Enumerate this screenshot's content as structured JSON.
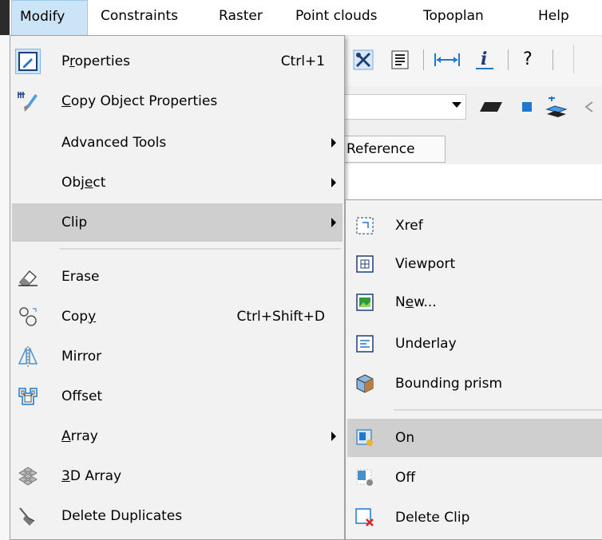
{
  "menubar": {
    "items": [
      {
        "label": "Modify"
      },
      {
        "label": "Constraints"
      },
      {
        "label": "Raster"
      },
      {
        "label": "Point clouds"
      },
      {
        "label": "Topoplan"
      },
      {
        "label": "Help"
      }
    ]
  },
  "background": {
    "reference_tab": "Reference",
    "toolbar_icons": [
      "tools-icon",
      "list-icon",
      "dimension-icon",
      "info-icon",
      "help-icon"
    ],
    "toolbar2_icons": [
      "combo-dropdown-arrow",
      "parallelogram-icon",
      "blue-square-icon",
      "layer-stack-icon"
    ]
  },
  "modify_menu": {
    "items": [
      {
        "label": "Properties",
        "shortcut": "Ctrl+1",
        "icon": "properties-icon",
        "checked": true
      },
      {
        "label": "Copy Object Properties",
        "shortcut": "",
        "icon": "match-properties-brush-icon"
      },
      {
        "label": "Advanced Tools",
        "shortcut": "",
        "submenu": true
      },
      {
        "label": "Object",
        "shortcut": "",
        "submenu": true
      },
      {
        "label": "Clip",
        "shortcut": "",
        "submenu": true,
        "highlighted": true
      },
      {
        "label": "Erase",
        "shortcut": "",
        "icon": "eraser-icon"
      },
      {
        "label": "Copy",
        "shortcut": "Ctrl+Shift+D",
        "icon": "copy-circles-icon"
      },
      {
        "label": "Mirror",
        "shortcut": "",
        "icon": "mirror-icon"
      },
      {
        "label": "Offset",
        "shortcut": "",
        "icon": "offset-icon"
      },
      {
        "label": "Array",
        "shortcut": "",
        "submenu": true
      },
      {
        "label": "3D Array",
        "shortcut": "",
        "icon": "3d-array-icon"
      },
      {
        "label": "Delete Duplicates",
        "shortcut": "",
        "icon": "delete-duplicates-icon"
      }
    ]
  },
  "clip_submenu": {
    "items": [
      {
        "label": "Xref",
        "icon": "xref-clip-icon"
      },
      {
        "label": "Viewport",
        "icon": "viewport-clip-icon"
      },
      {
        "label": "New...",
        "icon": "image-clip-icon"
      },
      {
        "label": "Underlay",
        "icon": "underlay-clip-icon"
      },
      {
        "label": "Bounding prism",
        "icon": "bounding-prism-icon"
      },
      {
        "label": "On",
        "icon": "clip-on-icon",
        "highlighted": true
      },
      {
        "label": "Off",
        "icon": "clip-off-icon"
      },
      {
        "label": "Delete Clip",
        "icon": "delete-clip-icon"
      }
    ]
  },
  "colors": {
    "menu_bg": "#f2f2f2",
    "highlight": "#cfcfcf",
    "active_menubar": "#cce4f7",
    "accent_blue": "#1e78d2",
    "delete_red": "#e02020"
  }
}
